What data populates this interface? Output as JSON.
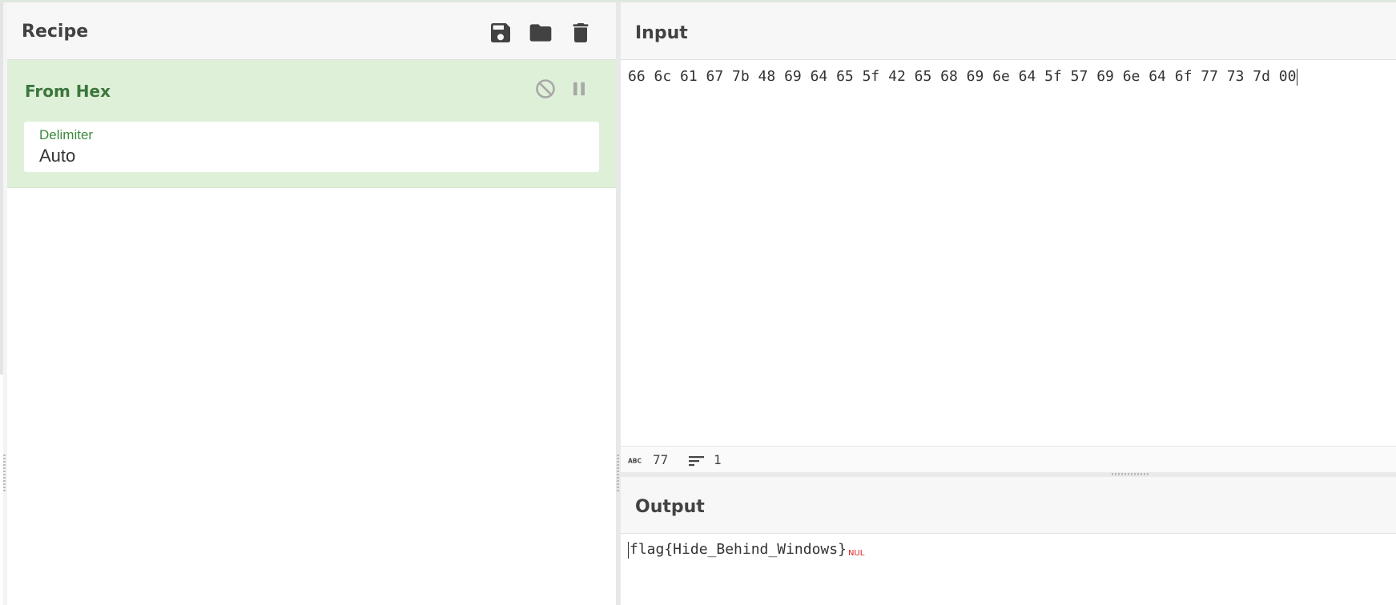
{
  "recipe": {
    "title": "Recipe",
    "icons": {
      "save": "save-icon",
      "load": "folder-icon",
      "clear": "trash-icon"
    },
    "operations": [
      {
        "name": "From Hex",
        "controls": {
          "disable": "disable-icon",
          "breakpoint": "pause-icon"
        },
        "args": [
          {
            "label": "Delimiter",
            "value": "Auto"
          }
        ]
      }
    ]
  },
  "input": {
    "title": "Input",
    "text": "66 6c 61 67 7b 48 69 64 65 5f 42 65 68 69 6e 64 5f 57 69 6e 64 6f 77 73 7d 00",
    "stats": {
      "length": "77",
      "lines": "1"
    }
  },
  "output": {
    "title": "Output",
    "text": "flag{Hide_Behind_Windows}",
    "nul_marker": "NUL"
  },
  "colors": {
    "op_background": "#dff0d8",
    "op_name": "#3c763d",
    "arg_label": "#3c8a3c",
    "header_bg": "#f7f7f7",
    "nul": "#e02020"
  }
}
